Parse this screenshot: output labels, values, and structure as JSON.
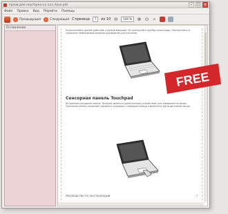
{
  "window": {
    "title": "Руков.для ноутбука Е1-521 Asus.pdf"
  },
  "menu": [
    "Файл",
    "Правка",
    "Вид",
    "Перейти",
    "Помощь"
  ],
  "toolbar": {
    "prev_label": "Предыдущая",
    "next_label": "Следующая",
    "page_label": "Страница",
    "page_value": "7",
    "page_of": "из 10",
    "zoom_value": "144 %"
  },
  "sidebar": {
    "header": "Оглавление"
  },
  "document": {
    "intro_text": "Не выполняйте данное действие с руками мокрыми. Не используйте ноутбук около воды. Распечатайте и сохраните необходимые разделы руководства для изучения.",
    "heading": "Сенсорная панель Touchpad",
    "body_text": "Встроенная сенсорная панель Touchpad является указательным устройством, она эквивалентна мыши. Сенсорная панель позволяет управлять курсором с помощью пальца и выполнять функции кнопок мыши.",
    "footer_code": "РУКОВОДСТВО ПО ЭКСПЛУАТАЦИИ",
    "page_number": "7"
  },
  "badge": {
    "label": "FREE",
    "color": "#d4272b"
  }
}
